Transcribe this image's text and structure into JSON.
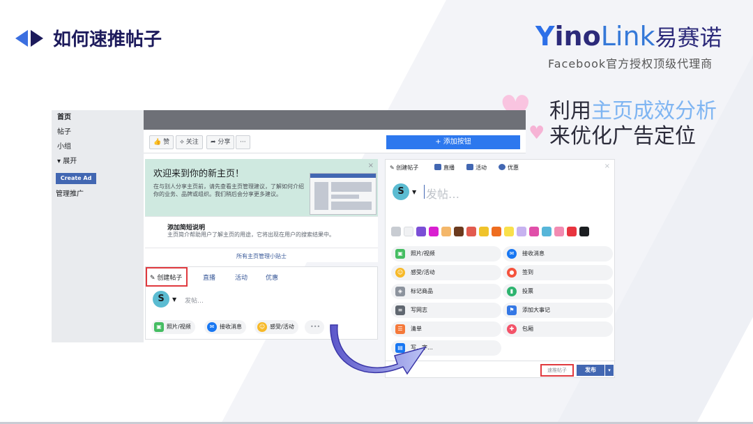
{
  "slide": {
    "title": "如何速推帖子",
    "callout_line1_a": "利用",
    "callout_line1_b": "主页成效分析",
    "callout_line2": "来优化广告定位"
  },
  "logo": {
    "brand_y": "Y",
    "brand_ino": "ino",
    "brand_link": "Link",
    "brand_cn": "易赛诺",
    "tagline": "Facebook官方授权顶级代理商"
  },
  "sidebar": {
    "items": [
      {
        "label": "首页"
      },
      {
        "label": "帖子"
      },
      {
        "label": "小组"
      },
      {
        "label": "▾ 展开"
      }
    ],
    "create_ad": "Create Ad",
    "manage_promo": "管理推广"
  },
  "page_actions": {
    "like": "👍 赞",
    "follow": "⟡ 关注",
    "share": "➦ 分享",
    "more": "···",
    "add_button": "+ 添加按钮"
  },
  "welcome": {
    "title": "欢迎来到你的新主页！",
    "body": "在与别人分享主页前，请先查看主页管理建议，了解如何介绍你的业务、品牌或组织。我们稍后会分享更多建议。",
    "close": "×"
  },
  "tip": {
    "title": "添加简短说明",
    "desc": "主页简介帮助用户了解主页的用途，它将出现在用户的搜索结果中。",
    "all_tips": "所有主页管理小贴士"
  },
  "composer": {
    "tabs": [
      "✎ 创建帖子",
      "直播",
      "活动",
      "优惠"
    ],
    "avatar_letter": "S",
    "placeholder": "发帖…",
    "chips": [
      "照片/视频",
      "接收消息",
      "感受/活动",
      "•••"
    ]
  },
  "expanded": {
    "tabs": [
      "✎ 创建帖子",
      "直播",
      "活动",
      "优惠"
    ],
    "placeholder": "发帖…",
    "options_left": [
      "照片/视频",
      "感受/活动",
      "标记商品",
      "写网志",
      "清单",
      "写…字…"
    ],
    "options_right": [
      "接收消息",
      "签到",
      "投票",
      "添加大事记",
      "包厢"
    ],
    "select_btn": "速推帖子",
    "publish": "发布",
    "dropdown": "▾"
  },
  "colors": {
    "accent": "#4267b2",
    "brand_dark": "#1d1b5c",
    "highlight": "#7fb5f2",
    "red_box": "#e0393e"
  }
}
